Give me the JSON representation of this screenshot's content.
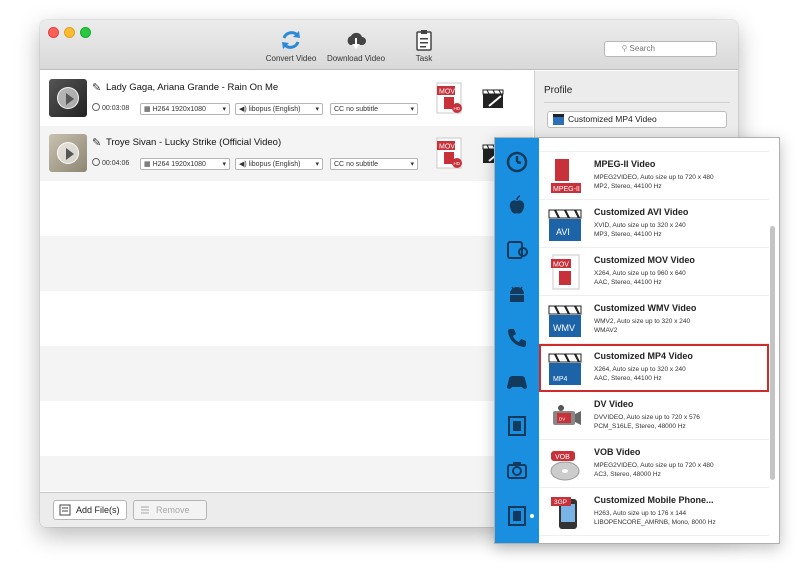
{
  "toolbar": {
    "convert_label": "Convert Video",
    "download_label": "Download Video",
    "task_label": "Task",
    "search_placeholder": "Search"
  },
  "files": [
    {
      "title": "Lady Gaga, Ariana Grande - Rain On Me",
      "duration": "00:03:08",
      "video": "H264 1920x1080",
      "audio": "libopus (English)",
      "subtitle": "no subtitle",
      "format_badge": "MOV",
      "format_sub": "HD"
    },
    {
      "title": "Troye Sivan - Lucky Strike (Official Video)",
      "duration": "00:04:06",
      "video": "H264 1920x1080",
      "audio": "libopus (English)",
      "subtitle": "no subtitle",
      "format_badge": "MOV",
      "format_sub": "HD"
    }
  ],
  "bottom": {
    "add_label": "Add File(s)",
    "remove_label": "Remove"
  },
  "profile": {
    "label": "Profile",
    "selected": "Customized MP4 Video"
  },
  "profiles": [
    {
      "name": "MPEG-II Video",
      "desc1": "MPEG2VIDEO, Auto size up to 720 x 480",
      "desc2": "MP2, Stereo, 44100 Hz",
      "desc3": "",
      "icon": "MPEG-II"
    },
    {
      "name": "Customized AVI Video",
      "desc1": "XVID, Auto size up to 320 x 240",
      "desc2": "MP3, Stereo, 44100 Hz",
      "desc3": "",
      "icon": "AVI"
    },
    {
      "name": "Customized MOV Video",
      "desc1": "X264, Auto size up to 960 x 640",
      "desc2": "AAC, Stereo, 44100 Hz",
      "desc3": "",
      "icon": "MOV"
    },
    {
      "name": "Customized WMV Video",
      "desc1": "WMV2, Auto size up to 320 x 240",
      "desc2": "WMAV2",
      "desc3": "",
      "icon": "WMV"
    },
    {
      "name": "Customized MP4 Video",
      "desc1": "X264, Auto size up to 320 x 240",
      "desc2": "AAC, Stereo, 44100 Hz",
      "desc3": "",
      "icon": "MP4"
    },
    {
      "name": "DV Video",
      "desc1": "DVVIDEO, Auto size up to 720 x 576",
      "desc2": "PCM_S16LE, Stereo, 48000 Hz",
      "desc3": "",
      "icon": "DV"
    },
    {
      "name": "VOB Video",
      "desc1": "MPEG2VIDEO, Auto size up to 720 x 480",
      "desc2": "AC3, Stereo, 48000 Hz",
      "desc3": "",
      "icon": "VOB"
    },
    {
      "name": "Customized Mobile Phone...",
      "desc1": "H263, Auto size up to 176 x 144",
      "desc2": "LIBOPENCORE_AMRNB, Mono, 8000 Hz",
      "desc3": "",
      "icon": "3GP"
    }
  ],
  "colors": {
    "sidebar_blue": "#1a8fe0",
    "selection_red": "#d12a2a",
    "mov_red": "#c8313a"
  }
}
